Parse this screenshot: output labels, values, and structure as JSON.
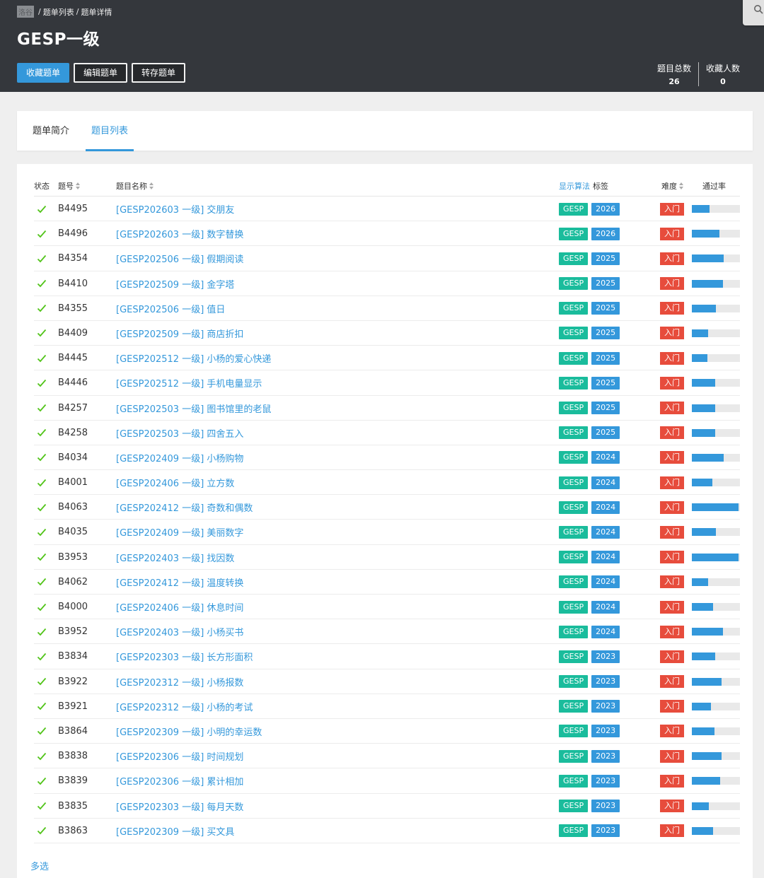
{
  "breadcrumb": {
    "home": "洛谷",
    "list": "题单列表",
    "current": "题单详情"
  },
  "title": "GESP一级",
  "actions": {
    "favorite": "收藏题单",
    "edit": "编辑题单",
    "save": "转存题单"
  },
  "stats": {
    "total_label": "题目总数",
    "total_value": "26",
    "fav_label": "收藏人数",
    "fav_value": "0"
  },
  "tabs": {
    "intro": "题单简介",
    "list": "题目列表"
  },
  "table": {
    "headers": {
      "status": "状态",
      "pid": "题号",
      "name": "题目名称",
      "show_algo": "显示算法",
      "tags": "标签",
      "difficulty": "难度",
      "pass_rate": "通过率"
    },
    "rows": [
      {
        "pid": "B4495",
        "name": "[GESP202603 一级] 交朋友",
        "tag1": "GESP",
        "tag2": "2026",
        "difficulty": "入门",
        "rate": 0.37
      },
      {
        "pid": "B4496",
        "name": "[GESP202603 一级] 数字替换",
        "tag1": "GESP",
        "tag2": "2026",
        "difficulty": "入门",
        "rate": 0.57
      },
      {
        "pid": "B4354",
        "name": "[GESP202506 一级] 假期阅读",
        "tag1": "GESP",
        "tag2": "2025",
        "difficulty": "入门",
        "rate": 0.66
      },
      {
        "pid": "B4410",
        "name": "[GESP202509 一级] 金字塔",
        "tag1": "GESP",
        "tag2": "2025",
        "difficulty": "入门",
        "rate": 0.64
      },
      {
        "pid": "B4355",
        "name": "[GESP202506 一级] 值日",
        "tag1": "GESP",
        "tag2": "2025",
        "difficulty": "入门",
        "rate": 0.5
      },
      {
        "pid": "B4409",
        "name": "[GESP202509 一级] 商店折扣",
        "tag1": "GESP",
        "tag2": "2025",
        "difficulty": "入门",
        "rate": 0.34
      },
      {
        "pid": "B4445",
        "name": "[GESP202512 一级] 小杨的爱心快递",
        "tag1": "GESP",
        "tag2": "2025",
        "difficulty": "入门",
        "rate": 0.32
      },
      {
        "pid": "B4446",
        "name": "[GESP202512 一级] 手机电量显示",
        "tag1": "GESP",
        "tag2": "2025",
        "difficulty": "入门",
        "rate": 0.49
      },
      {
        "pid": "B4257",
        "name": "[GESP202503 一级] 图书馆里的老鼠",
        "tag1": "GESP",
        "tag2": "2025",
        "difficulty": "入门",
        "rate": 0.49
      },
      {
        "pid": "B4258",
        "name": "[GESP202503 一级] 四舍五入",
        "tag1": "GESP",
        "tag2": "2025",
        "difficulty": "入门",
        "rate": 0.49
      },
      {
        "pid": "B4034",
        "name": "[GESP202409 一级] 小杨购物",
        "tag1": "GESP",
        "tag2": "2024",
        "difficulty": "入门",
        "rate": 0.66
      },
      {
        "pid": "B4001",
        "name": "[GESP202406 一级] 立方数",
        "tag1": "GESP",
        "tag2": "2024",
        "difficulty": "入门",
        "rate": 0.43
      },
      {
        "pid": "B4063",
        "name": "[GESP202412 一级] 奇数和偶数",
        "tag1": "GESP",
        "tag2": "2024",
        "difficulty": "入门",
        "rate": 0.97
      },
      {
        "pid": "B4035",
        "name": "[GESP202409 一级] 美丽数字",
        "tag1": "GESP",
        "tag2": "2024",
        "difficulty": "入门",
        "rate": 0.5
      },
      {
        "pid": "B3953",
        "name": "[GESP202403 一级] 找因数",
        "tag1": "GESP",
        "tag2": "2024",
        "difficulty": "入门",
        "rate": 0.97
      },
      {
        "pid": "B4062",
        "name": "[GESP202412 一级] 温度转换",
        "tag1": "GESP",
        "tag2": "2024",
        "difficulty": "入门",
        "rate": 0.34
      },
      {
        "pid": "B4000",
        "name": "[GESP202406 一级] 休息时间",
        "tag1": "GESP",
        "tag2": "2024",
        "difficulty": "入门",
        "rate": 0.44
      },
      {
        "pid": "B3952",
        "name": "[GESP202403 一级] 小杨买书",
        "tag1": "GESP",
        "tag2": "2024",
        "difficulty": "入门",
        "rate": 0.65
      },
      {
        "pid": "B3834",
        "name": "[GESP202303 一级] 长方形面积",
        "tag1": "GESP",
        "tag2": "2023",
        "difficulty": "入门",
        "rate": 0.49
      },
      {
        "pid": "B3922",
        "name": "[GESP202312 一级] 小杨报数",
        "tag1": "GESP",
        "tag2": "2023",
        "difficulty": "入门",
        "rate": 0.62
      },
      {
        "pid": "B3921",
        "name": "[GESP202312 一级] 小杨的考试",
        "tag1": "GESP",
        "tag2": "2023",
        "difficulty": "入门",
        "rate": 0.4
      },
      {
        "pid": "B3864",
        "name": "[GESP202309 一级] 小明的幸运数",
        "tag1": "GESP",
        "tag2": "2023",
        "difficulty": "入门",
        "rate": 0.47
      },
      {
        "pid": "B3838",
        "name": "[GESP202306 一级] 时间规划",
        "tag1": "GESP",
        "tag2": "2023",
        "difficulty": "入门",
        "rate": 0.62
      },
      {
        "pid": "B3839",
        "name": "[GESP202306 一级] 累计相加",
        "tag1": "GESP",
        "tag2": "2023",
        "difficulty": "入门",
        "rate": 0.59
      },
      {
        "pid": "B3835",
        "name": "[GESP202303 一级] 每月天数",
        "tag1": "GESP",
        "tag2": "2023",
        "difficulty": "入门",
        "rate": 0.35
      },
      {
        "pid": "B3863",
        "name": "[GESP202309 一级] 买文具",
        "tag1": "GESP",
        "tag2": "2023",
        "difficulty": "入门",
        "rate": 0.44
      }
    ]
  },
  "footer": {
    "multi_select": "多选"
  },
  "colors": {
    "accent": "#3498db",
    "tag_gesp": "#1abc9c",
    "difficulty": "#e74c3c",
    "status_ok": "#52c41a",
    "header_bg": "#34373c"
  }
}
